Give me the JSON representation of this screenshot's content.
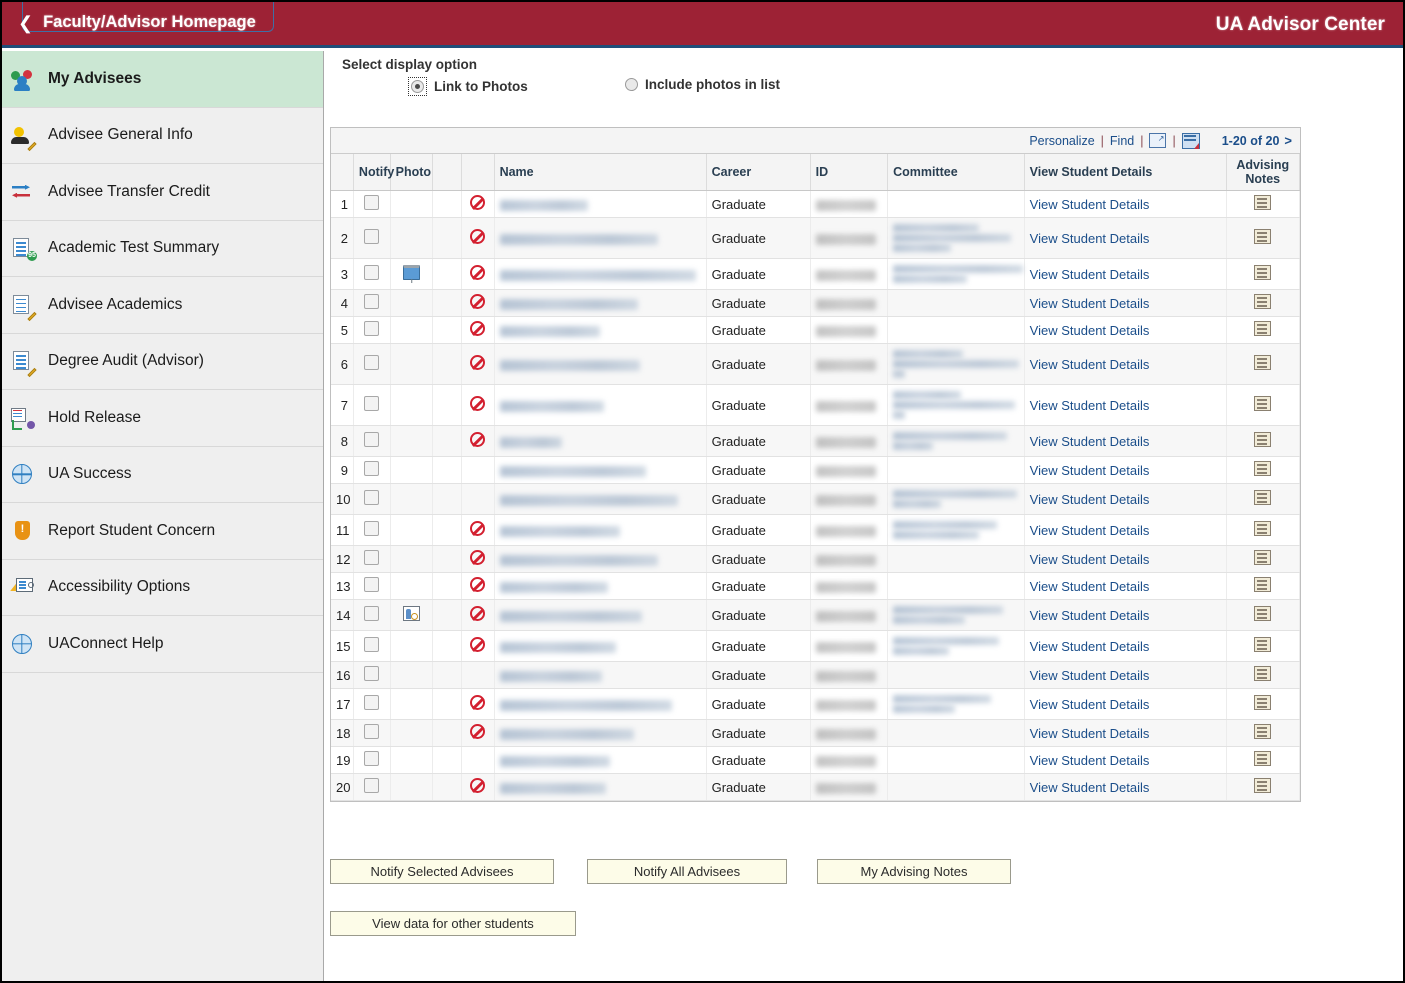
{
  "header": {
    "back_label": "Faculty/Advisor Homepage",
    "back_icon": "chevron-left-icon",
    "brand": "UA Advisor Center",
    "bar_color": "#9d2235",
    "accent_color": "#1f4e79"
  },
  "sidebar": {
    "items": [
      {
        "label": "My Advisees",
        "icon": "people-group-icon",
        "active": true
      },
      {
        "label": "Advisee General Info",
        "icon": "person-pencil-icon",
        "active": false
      },
      {
        "label": "Advisee Transfer Credit",
        "icon": "transfer-arrows-icon",
        "active": false
      },
      {
        "label": "Academic Test Summary",
        "icon": "test-score-icon",
        "active": false
      },
      {
        "label": "Advisee Academics",
        "icon": "document-pencil-icon",
        "active": false
      },
      {
        "label": "Degree Audit (Advisor)",
        "icon": "document-pencil-icon",
        "active": false
      },
      {
        "label": "Hold Release",
        "icon": "hold-release-icon",
        "active": false
      },
      {
        "label": "UA Success",
        "icon": "globe-icon",
        "active": false
      },
      {
        "label": "Report Student Concern",
        "icon": "shield-alert-icon",
        "active": false
      },
      {
        "label": "Accessibility Options",
        "icon": "accessibility-icon",
        "active": false
      },
      {
        "label": "UAConnect Help",
        "icon": "globe-icon",
        "active": false
      }
    ],
    "active_highlight": "#cbe7d3"
  },
  "display_option": {
    "title": "Select display option",
    "options": [
      {
        "label": "Link to Photos",
        "selected": true,
        "focused": true
      },
      {
        "label": "Include photos in list",
        "selected": false,
        "focused": false
      }
    ]
  },
  "grid_toolbar": {
    "personalize": "Personalize",
    "find": "Find",
    "view_all_icon": "view-all-icon",
    "download_icon": "download-spreadsheet-icon",
    "separator": "|",
    "range": "1-20 of 20",
    "next": ">"
  },
  "table": {
    "columns": [
      {
        "key": "rownum",
        "label": ""
      },
      {
        "key": "notify",
        "label": "Notify"
      },
      {
        "key": "photo",
        "label": "Photo"
      },
      {
        "key": "blank",
        "label": ""
      },
      {
        "key": "hold",
        "label": ""
      },
      {
        "key": "name",
        "label": "Name"
      },
      {
        "key": "career",
        "label": "Career"
      },
      {
        "key": "id",
        "label": "ID"
      },
      {
        "key": "committee",
        "label": "Committee"
      },
      {
        "key": "details",
        "label": "View Student Details"
      },
      {
        "key": "notes",
        "label": "Advising Notes"
      }
    ],
    "details_link_label": "View Student Details",
    "note_icon": "advising-note-icon",
    "hold_icon": "hold-indicator-icon",
    "rows": [
      {
        "num": "1",
        "photo_icon": "",
        "hold": true,
        "name_w": 88,
        "career": "Graduate",
        "id_w": 60,
        "committee_lines": []
      },
      {
        "num": "2",
        "photo_icon": "",
        "hold": true,
        "name_w": 158,
        "career": "Graduate",
        "id_w": 60,
        "committee_lines": [
          86,
          118,
          58
        ]
      },
      {
        "num": "3",
        "photo_icon": "screen-icon",
        "hold": true,
        "name_w": 196,
        "career": "Graduate",
        "id_w": 60,
        "committee_lines": [
          130,
          74
        ]
      },
      {
        "num": "4",
        "photo_icon": "",
        "hold": true,
        "name_w": 138,
        "career": "Graduate",
        "id_w": 60,
        "committee_lines": []
      },
      {
        "num": "5",
        "photo_icon": "",
        "hold": true,
        "name_w": 100,
        "career": "Graduate",
        "id_w": 60,
        "committee_lines": []
      },
      {
        "num": "6",
        "photo_icon": "",
        "hold": true,
        "name_w": 140,
        "career": "Graduate",
        "id_w": 60,
        "committee_lines": [
          70,
          126,
          12
        ]
      },
      {
        "num": "7",
        "photo_icon": "",
        "hold": true,
        "name_w": 104,
        "career": "Graduate",
        "id_w": 60,
        "committee_lines": [
          68,
          122,
          12
        ]
      },
      {
        "num": "8",
        "photo_icon": "",
        "hold": true,
        "name_w": 62,
        "career": "Graduate",
        "id_w": 60,
        "committee_lines": [
          114,
          40
        ]
      },
      {
        "num": "9",
        "photo_icon": "",
        "hold": false,
        "name_w": 146,
        "career": "Graduate",
        "id_w": 60,
        "committee_lines": []
      },
      {
        "num": "10",
        "photo_icon": "",
        "hold": false,
        "name_w": 178,
        "career": "Graduate",
        "id_w": 60,
        "committee_lines": [
          124,
          48
        ]
      },
      {
        "num": "11",
        "photo_icon": "",
        "hold": true,
        "name_w": 120,
        "career": "Graduate",
        "id_w": 60,
        "committee_lines": [
          104,
          86
        ]
      },
      {
        "num": "12",
        "photo_icon": "",
        "hold": true,
        "name_w": 158,
        "career": "Graduate",
        "id_w": 60,
        "committee_lines": []
      },
      {
        "num": "13",
        "photo_icon": "",
        "hold": true,
        "name_w": 108,
        "career": "Graduate",
        "id_w": 60,
        "committee_lines": []
      },
      {
        "num": "14",
        "photo_icon": "person-search-icon",
        "hold": true,
        "name_w": 142,
        "career": "Graduate",
        "id_w": 60,
        "committee_lines": [
          110,
          72
        ]
      },
      {
        "num": "15",
        "photo_icon": "",
        "hold": true,
        "name_w": 116,
        "career": "Graduate",
        "id_w": 60,
        "committee_lines": [
          106,
          56
        ]
      },
      {
        "num": "16",
        "photo_icon": "",
        "hold": false,
        "name_w": 102,
        "career": "Graduate",
        "id_w": 60,
        "committee_lines": []
      },
      {
        "num": "17",
        "photo_icon": "",
        "hold": true,
        "name_w": 172,
        "career": "Graduate",
        "id_w": 60,
        "committee_lines": [
          98,
          62
        ]
      },
      {
        "num": "18",
        "photo_icon": "",
        "hold": true,
        "name_w": 134,
        "career": "Graduate",
        "id_w": 60,
        "committee_lines": []
      },
      {
        "num": "19",
        "photo_icon": "",
        "hold": false,
        "name_w": 110,
        "career": "Graduate",
        "id_w": 60,
        "committee_lines": []
      },
      {
        "num": "20",
        "photo_icon": "",
        "hold": true,
        "name_w": 106,
        "career": "Graduate",
        "id_w": 60,
        "committee_lines": []
      }
    ]
  },
  "buttons": {
    "notify_selected": "Notify Selected Advisees",
    "notify_all": "Notify All Advisees",
    "my_advising_notes": "My Advising Notes",
    "view_other_students": "View data for other students"
  }
}
